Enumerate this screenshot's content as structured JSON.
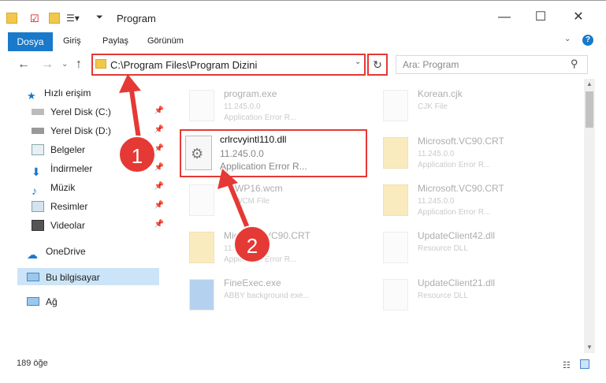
{
  "window": {
    "title": "Program"
  },
  "ribbon": {
    "tabs": [
      "Dosya",
      "Giriş",
      "Paylaş",
      "Görünüm"
    ]
  },
  "address": {
    "path": "C:\\Program Files\\Program Dizini"
  },
  "search": {
    "placeholder": "Ara: Program"
  },
  "sidebar": {
    "items": [
      "Hızlı erişim",
      "Yerel Disk (C:)",
      "Yerel Disk (D:)",
      "Belgeler",
      "İndirmeler",
      "Müzik",
      "Resimler",
      "Videolar",
      "OneDrive",
      "Bu bilgisayar",
      "Ağ"
    ]
  },
  "files": {
    "program": {
      "name": "program.exe",
      "l2": "11.245.0.0",
      "l3": "Application Error R..."
    },
    "korean": {
      "name": "Korean.cjk",
      "l2": "CJK File"
    },
    "crl": {
      "name": "crlrcvyintl110.dll",
      "l2": "11.245.0.0",
      "l3": "Application Error R..."
    },
    "vc1": {
      "name": "Microsoft.VC90.CRT",
      "l2": "11.245.0.0",
      "l3": "Application Error R..."
    },
    "wcm": {
      "name": "WP16.wcm",
      "l2": "WCM File"
    },
    "vc2": {
      "name": "Microsoft.VC90.CRT",
      "l2": "11.245.0.0",
      "l3": "Application Error R..."
    },
    "vc3": {
      "name": "Microsoft.VC90.CRT",
      "l2": "11.245.0.0",
      "l3": "Application Error R..."
    },
    "upd42": {
      "name": "UpdateClient42.dll",
      "l2": "Resource DLL"
    },
    "fine": {
      "name": "FineExec.exe",
      "l2": "ABBY background exe..."
    },
    "upd21": {
      "name": "UpdateClient21.dll",
      "l2": "Resource DLL"
    }
  },
  "status": {
    "count": "189 öğe"
  },
  "annotations": {
    "one": "1",
    "two": "2"
  },
  "colors": {
    "accent": "#1979ca",
    "highlight": "#e53935"
  }
}
